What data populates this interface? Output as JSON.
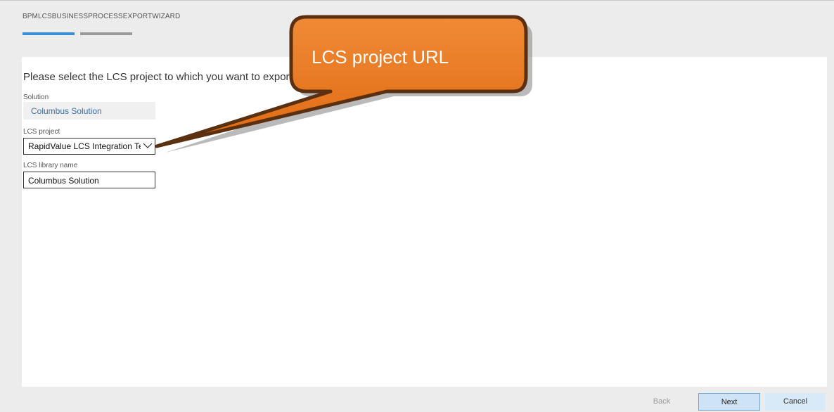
{
  "wizard": {
    "title": "BPMLCSBUSINESSPROCESSEXPORTWIZARD"
  },
  "content": {
    "instruction": "Please select the LCS project to which you want to export th"
  },
  "fields": {
    "solution_label": "Solution",
    "solution_value": "Columbus Solution",
    "project_label": "LCS project",
    "project_value": "RapidValue LCS Integration Test",
    "library_label": "LCS library name",
    "library_value": "Columbus Solution"
  },
  "footer": {
    "back_label": "Back",
    "next_label": "Next",
    "cancel_label": "Cancel"
  },
  "callout": {
    "text": "LCS project URL",
    "color": "#e87722"
  },
  "colors": {
    "accent": "#3a8fd8",
    "link_text": "#3a6ea5"
  },
  "icons": {
    "dropdown": "chevron-down-icon"
  }
}
